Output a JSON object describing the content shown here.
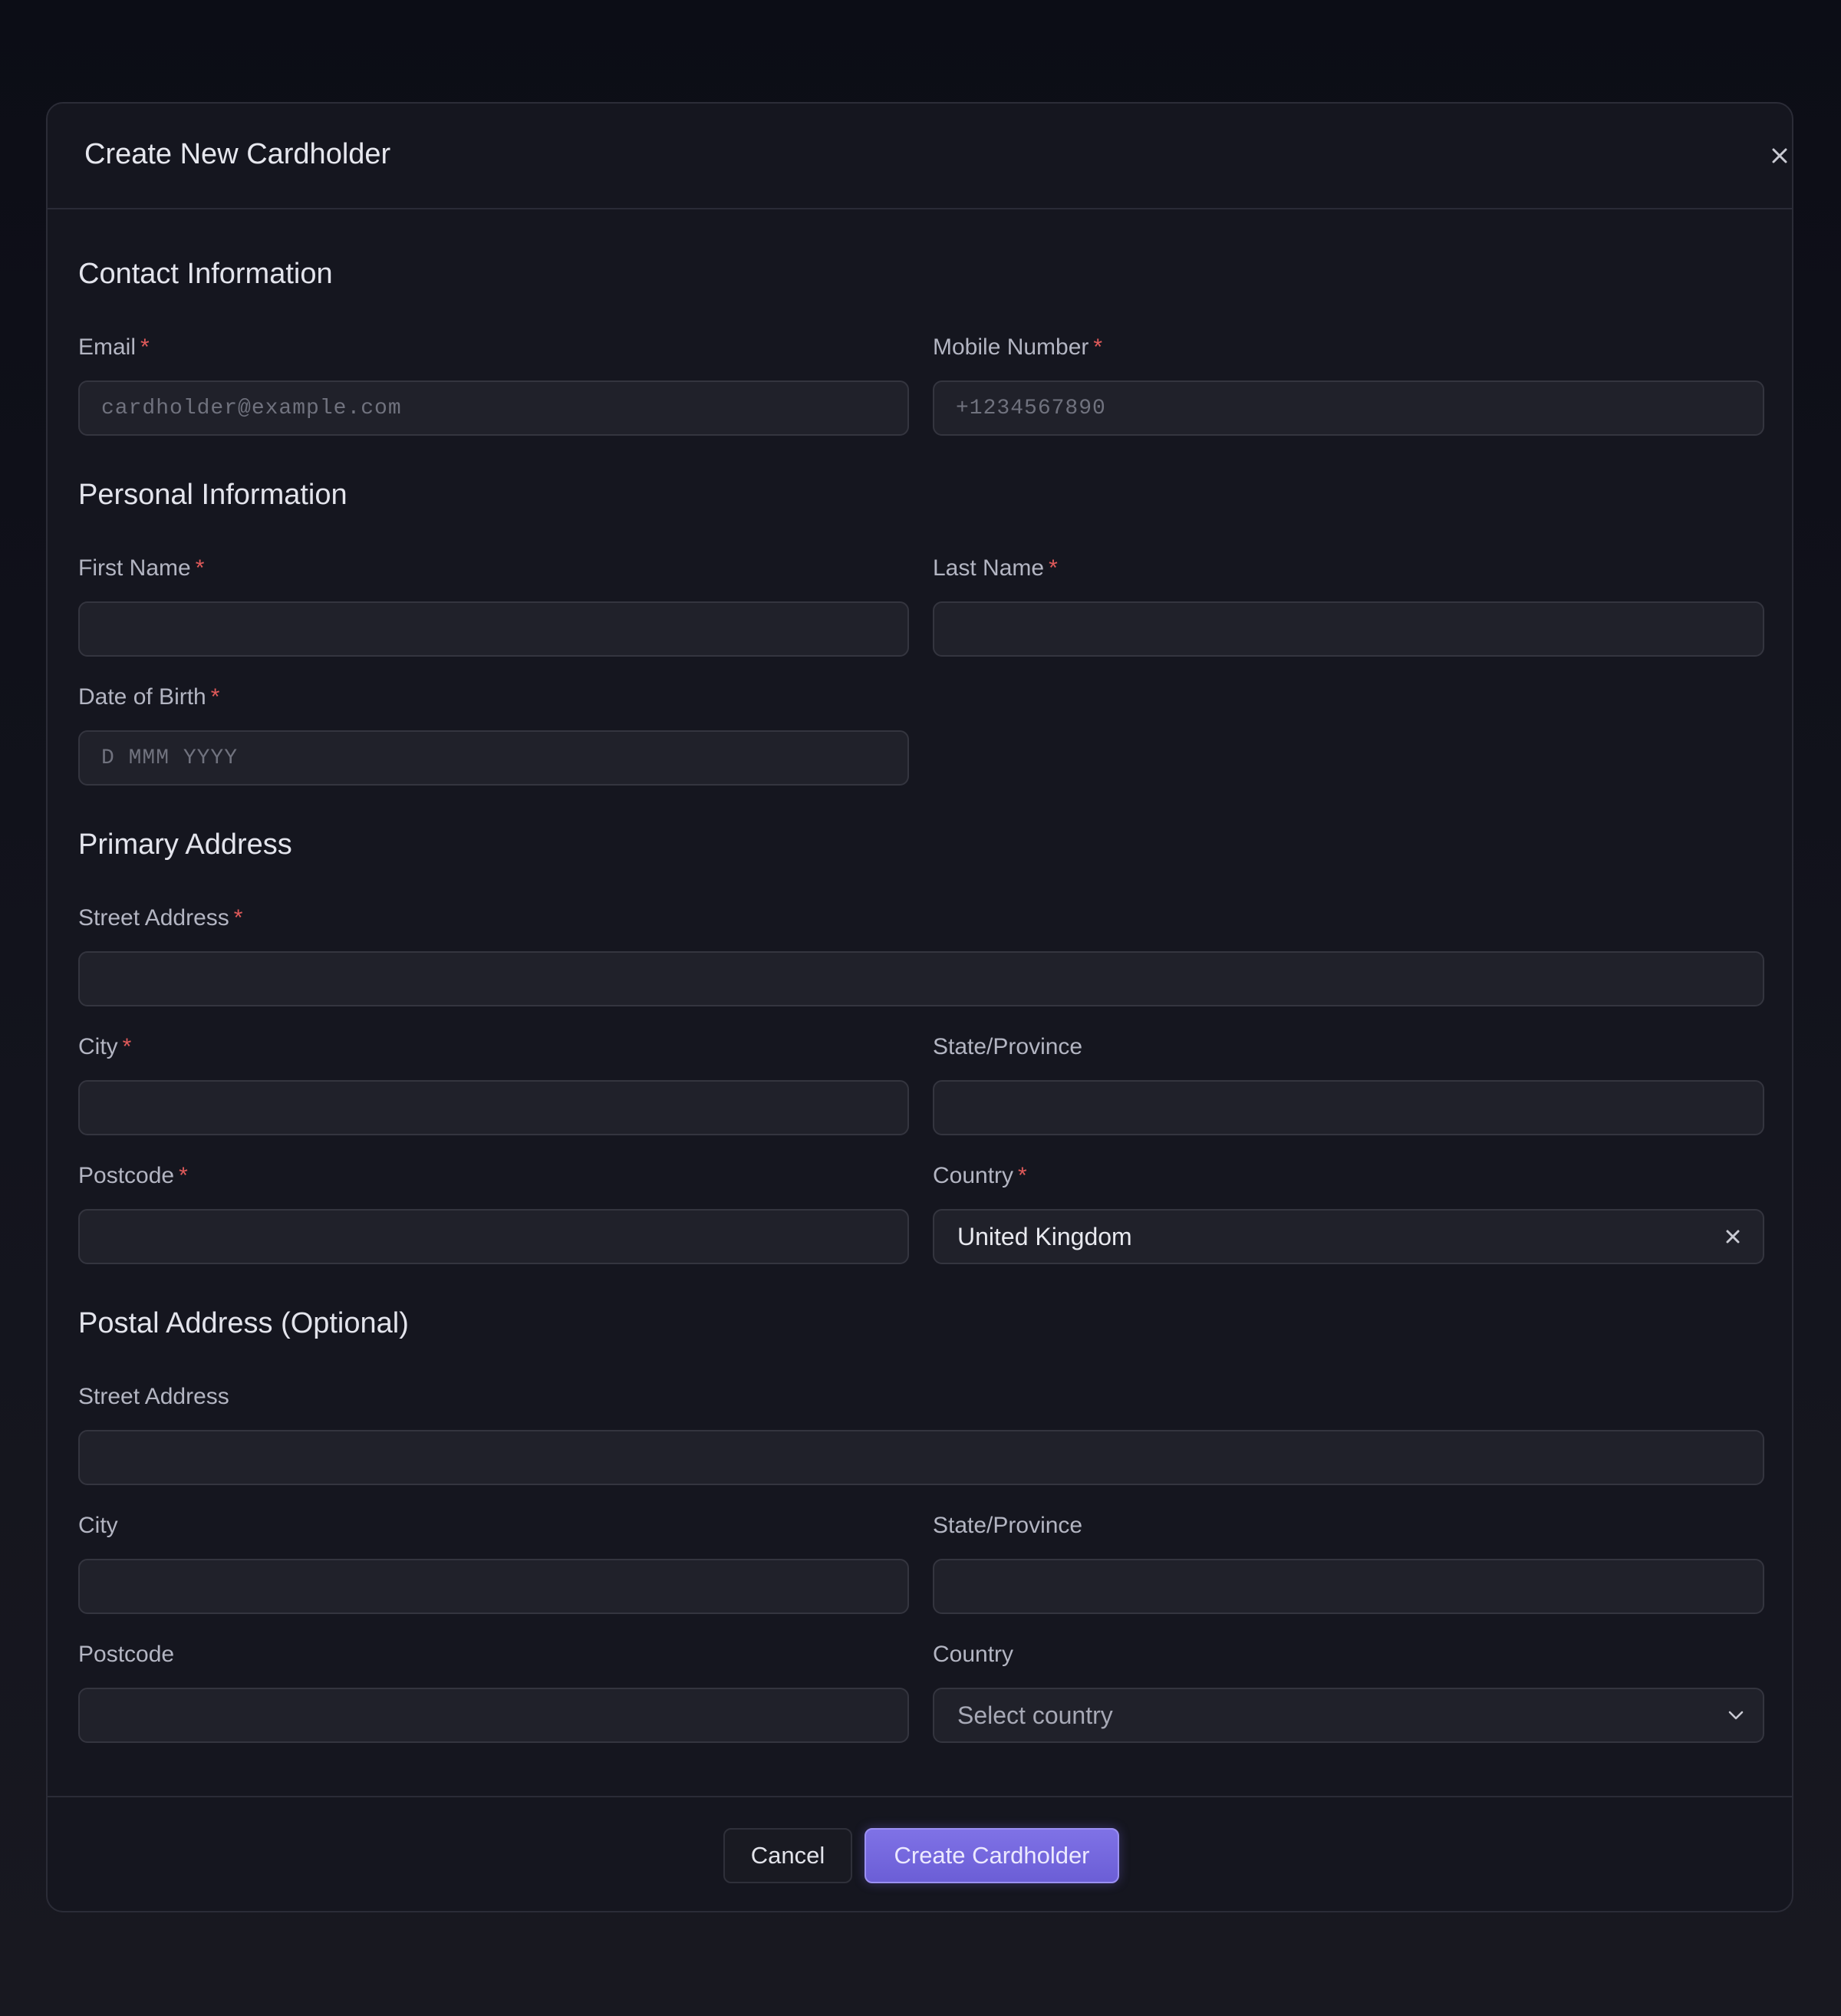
{
  "modal": {
    "title": "Create New Cardholder"
  },
  "sections": {
    "contact": "Contact Information",
    "personal": "Personal Information",
    "primary": "Primary Address",
    "postal": "Postal Address (Optional)"
  },
  "required_marker": "*",
  "contact": {
    "email_label": "Email",
    "email_placeholder": "cardholder@example.com",
    "mobile_label": "Mobile Number",
    "mobile_placeholder": "+1234567890"
  },
  "personal": {
    "first_name_label": "First Name",
    "last_name_label": "Last Name",
    "dob_label": "Date of Birth",
    "dob_placeholder": "D MMM YYYY"
  },
  "primary_address": {
    "street_label": "Street Address",
    "city_label": "City",
    "state_label": "State/Province",
    "postcode_label": "Postcode",
    "country_label": "Country",
    "country_value": "United Kingdom"
  },
  "postal_address": {
    "street_label": "Street Address",
    "city_label": "City",
    "state_label": "State/Province",
    "postcode_label": "Postcode",
    "country_label": "Country",
    "country_placeholder": "Select country"
  },
  "footer": {
    "cancel_label": "Cancel",
    "create_label": "Create Cardholder"
  },
  "colors": {
    "background": "#0d0e16",
    "modal": "#15161f",
    "input": "#20212a",
    "required": "#e05a5a",
    "accent": "#7569e0"
  },
  "icons": {
    "close": "close-icon",
    "clear": "clear-icon",
    "dropdown": "chevron-down-icon"
  }
}
